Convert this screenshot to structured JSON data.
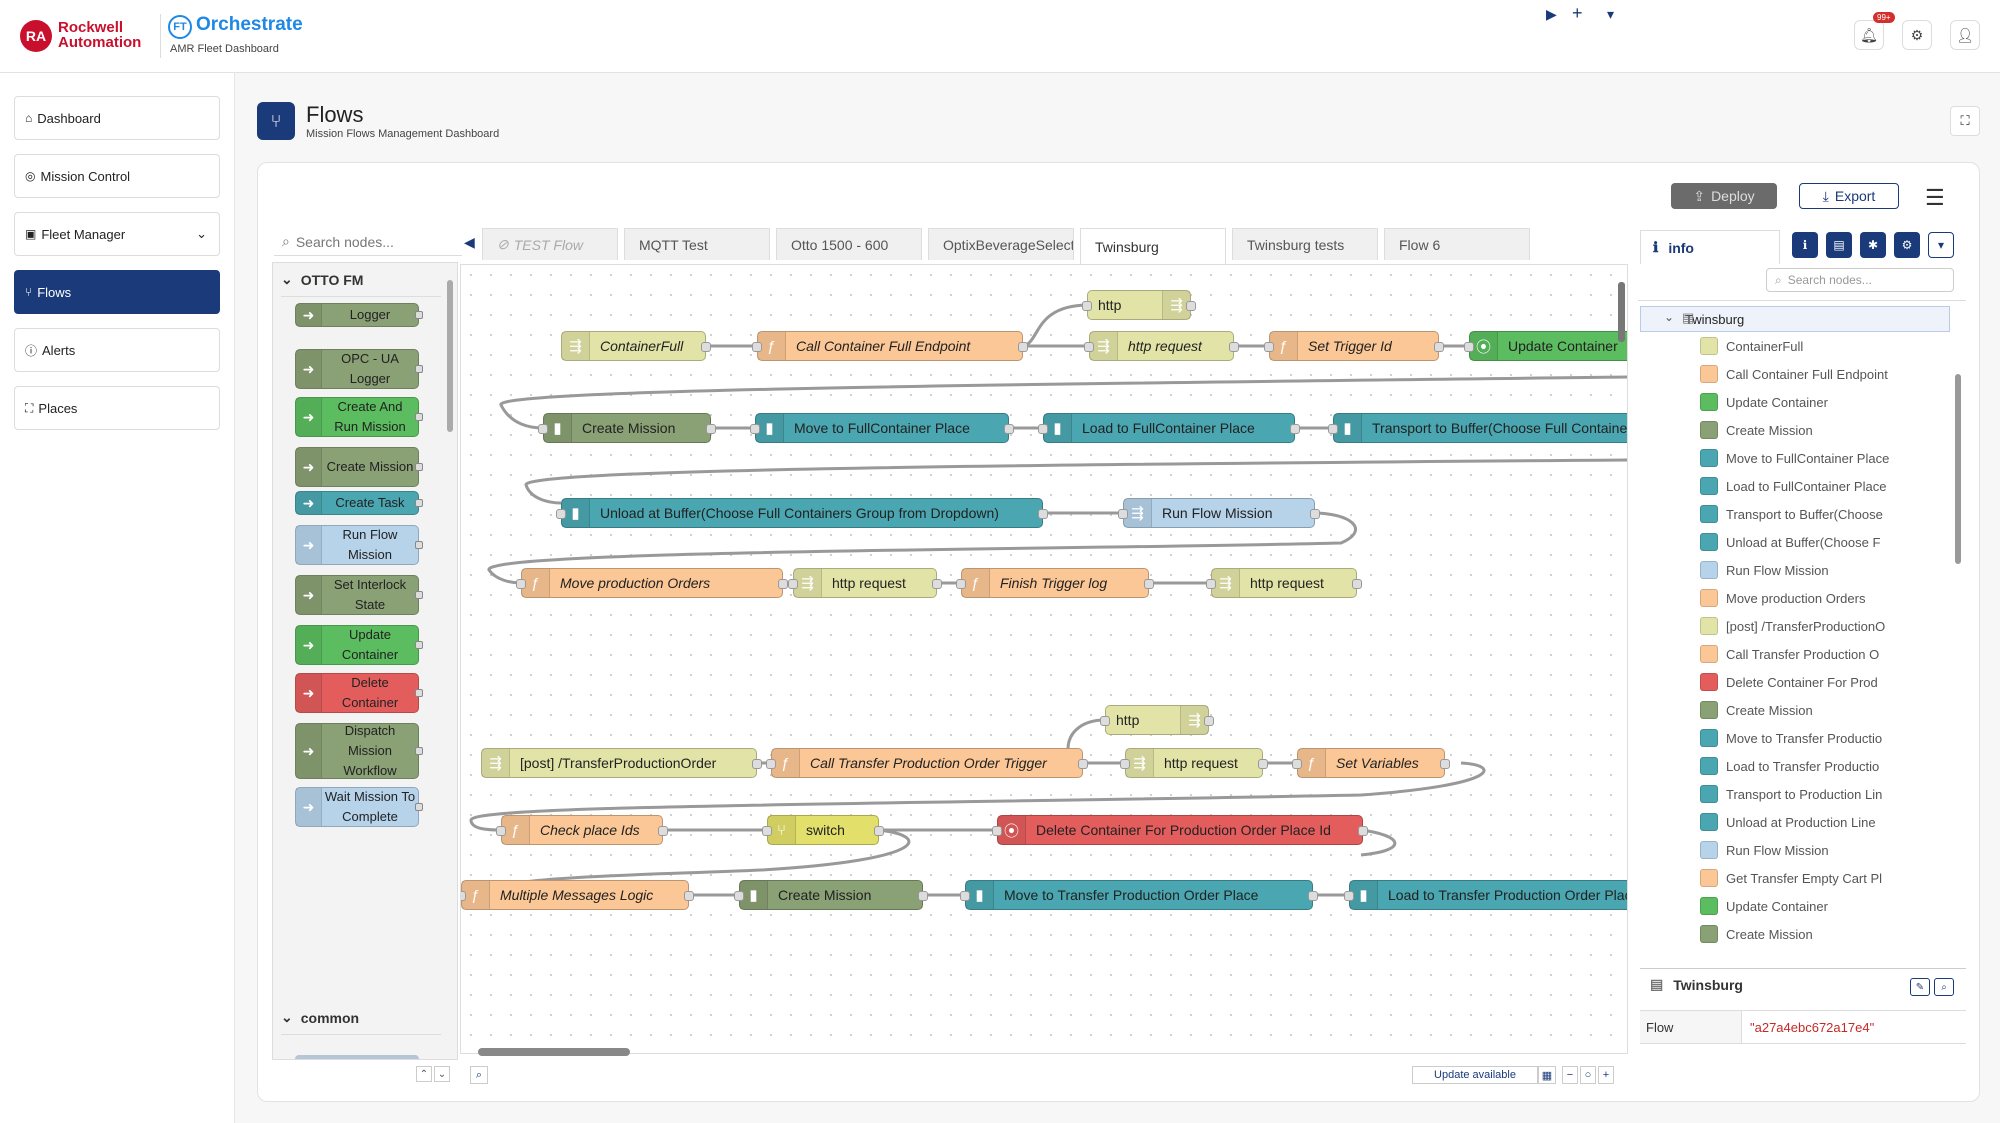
{
  "header": {
    "ra_logo": "RA",
    "brand_line1": "Rockwell",
    "brand_line2": "Automation",
    "ft_logo": "FT",
    "product": "Orchestrate",
    "product_sub": "AMR Fleet Dashboard",
    "notif_badge": "99+",
    "icons": [
      "bell-icon",
      "gear-icon",
      "user-icon"
    ]
  },
  "sidebar": {
    "items": [
      {
        "label": "Dashboard",
        "icon": "home-icon",
        "active": false
      },
      {
        "label": "Mission Control",
        "icon": "target-icon",
        "active": false
      },
      {
        "label": "Fleet Manager",
        "icon": "robot-icon",
        "active": false
      },
      {
        "label": "Flows",
        "icon": "flow-icon",
        "active": true
      },
      {
        "label": "Alerts",
        "icon": "alert-icon",
        "active": false
      },
      {
        "label": "Places",
        "icon": "places-icon",
        "active": false
      }
    ]
  },
  "page": {
    "title": "Flows",
    "subtitle": "Mission Flows Management Dashboard"
  },
  "toolbar": {
    "deploy": "Deploy",
    "export": "Export"
  },
  "palette": {
    "search_placeholder": "Search nodes...",
    "category1": "OTTO FM",
    "category2": "common",
    "nodes": [
      {
        "label": "Logger",
        "color": "#8aa075"
      },
      {
        "label": "OPC - UA Logger",
        "color": "#8aa075"
      },
      {
        "label": "Create And Run Mission",
        "color": "#5bbd5f"
      },
      {
        "label": "Create Mission",
        "color": "#8aa075"
      },
      {
        "label": "Create Task",
        "color": "#4aa6b0"
      },
      {
        "label": "Run Flow Mission",
        "color": "#b6d3ea"
      },
      {
        "label": "Set Interlock State",
        "color": "#8aa075"
      },
      {
        "label": "Update Container",
        "color": "#5bbd5f"
      },
      {
        "label": "Delete Container",
        "color": "#e45d5d"
      },
      {
        "label": "Dispatch Mission Workflow",
        "color": "#8aa075"
      },
      {
        "label": "Wait Mission To Complete",
        "color": "#b6d3ea"
      }
    ]
  },
  "tabs": [
    {
      "label": "TEST Flow",
      "disabled": true
    },
    {
      "label": "MQTT Test"
    },
    {
      "label": "Otto 1500 - 600"
    },
    {
      "label": "OptixBeverageSelection"
    },
    {
      "label": "Twinsburg",
      "active": true
    },
    {
      "label": "Twinsburg tests"
    },
    {
      "label": "Flow 6"
    }
  ],
  "flow_nodes": [
    {
      "label": "http",
      "color": "#e2e4a7"
    },
    {
      "label": "ContainerFull",
      "color": "#e2e4a7"
    },
    {
      "label": "Call Container Full Endpoint",
      "color": "#fbc796"
    },
    {
      "label": "http request",
      "color": "#e2e4a7"
    },
    {
      "label": "Set Trigger Id",
      "color": "#fbc796"
    },
    {
      "label": "Update Container",
      "color": "#5bbd5f"
    },
    {
      "label": "Create Mission",
      "color": "#8aa075"
    },
    {
      "label": "Move to FullContainer Place",
      "color": "#4aa6b0"
    },
    {
      "label": "Load to FullContainer Place",
      "color": "#4aa6b0"
    },
    {
      "label": "Transport to Buffer(Choose Full Containers Group from Dropdown)",
      "color": "#4aa6b0"
    },
    {
      "label": "Unload at Buffer(Choose Full Containers Group from Dropdown)",
      "color": "#4aa6b0"
    },
    {
      "label": "Run Flow Mission",
      "color": "#b6d3ea"
    },
    {
      "label": "Move production Orders",
      "color": "#fbc796"
    },
    {
      "label": "http request",
      "color": "#e2e4a7"
    },
    {
      "label": "Finish Trigger log",
      "color": "#fbc796"
    },
    {
      "label": "http request",
      "color": "#e2e4a7"
    },
    {
      "label": "http",
      "color": "#e2e4a7"
    },
    {
      "label": "[post] /TransferProductionOrder",
      "color": "#e2e4a7"
    },
    {
      "label": "Call Transfer Production Order Trigger",
      "color": "#fbc796"
    },
    {
      "label": "http request",
      "color": "#e2e4a7"
    },
    {
      "label": "Set Variables",
      "color": "#fbc796"
    },
    {
      "label": "Check place Ids",
      "color": "#fbc796"
    },
    {
      "label": "switch",
      "color": "#e2e06a"
    },
    {
      "label": "Delete Container For Production Order Place Id",
      "color": "#e45d5d"
    },
    {
      "label": "Multiple Messages Logic",
      "color": "#fbc796"
    },
    {
      "label": "Create Mission",
      "color": "#8aa075"
    },
    {
      "label": "Move to Transfer Production Order Place",
      "color": "#4aa6b0"
    },
    {
      "label": "Load to Transfer Production Order Place",
      "color": "#4aa6b0"
    }
  ],
  "workspace_footer": {
    "update": "Update available"
  },
  "info": {
    "tab": "info",
    "search_placeholder": "Search nodes...",
    "flow_name": "Twinsburg",
    "items": [
      {
        "label": "ContainerFull",
        "color": "#e2e4a7"
      },
      {
        "label": "Call Container Full Endpoint",
        "color": "#fbc796"
      },
      {
        "label": "Update Container",
        "color": "#5bbd5f"
      },
      {
        "label": "Create Mission",
        "color": "#8aa075"
      },
      {
        "label": "Move to FullContainer Place",
        "color": "#4aa6b0"
      },
      {
        "label": "Load to FullContainer Place",
        "color": "#4aa6b0"
      },
      {
        "label": "Transport to Buffer(Choose",
        "color": "#4aa6b0"
      },
      {
        "label": "Unload at Buffer(Choose F",
        "color": "#4aa6b0"
      },
      {
        "label": "Run Flow Mission",
        "color": "#b6d3ea"
      },
      {
        "label": "Move production Orders",
        "color": "#fbc796"
      },
      {
        "label": "[post] /TransferProductionO",
        "color": "#e2e4a7"
      },
      {
        "label": "Call Transfer Production O",
        "color": "#fbc796"
      },
      {
        "label": "Delete Container For Prod",
        "color": "#e45d5d"
      },
      {
        "label": "Create Mission",
        "color": "#8aa075"
      },
      {
        "label": "Move to Transfer Productio",
        "color": "#4aa6b0"
      },
      {
        "label": "Load to Transfer Productio",
        "color": "#4aa6b0"
      },
      {
        "label": "Transport to Production Lin",
        "color": "#4aa6b0"
      },
      {
        "label": "Unload at Production Line",
        "color": "#4aa6b0"
      },
      {
        "label": "Run Flow Mission",
        "color": "#b6d3ea"
      },
      {
        "label": "Get Transfer Empty Cart Pl",
        "color": "#fbc796"
      },
      {
        "label": "Update Container",
        "color": "#5bbd5f"
      },
      {
        "label": "Create Mission",
        "color": "#8aa075"
      }
    ],
    "props_title": "Twinsburg",
    "prop_key": "Flow",
    "prop_value": "\"a27a4ebc672a17e4\""
  }
}
